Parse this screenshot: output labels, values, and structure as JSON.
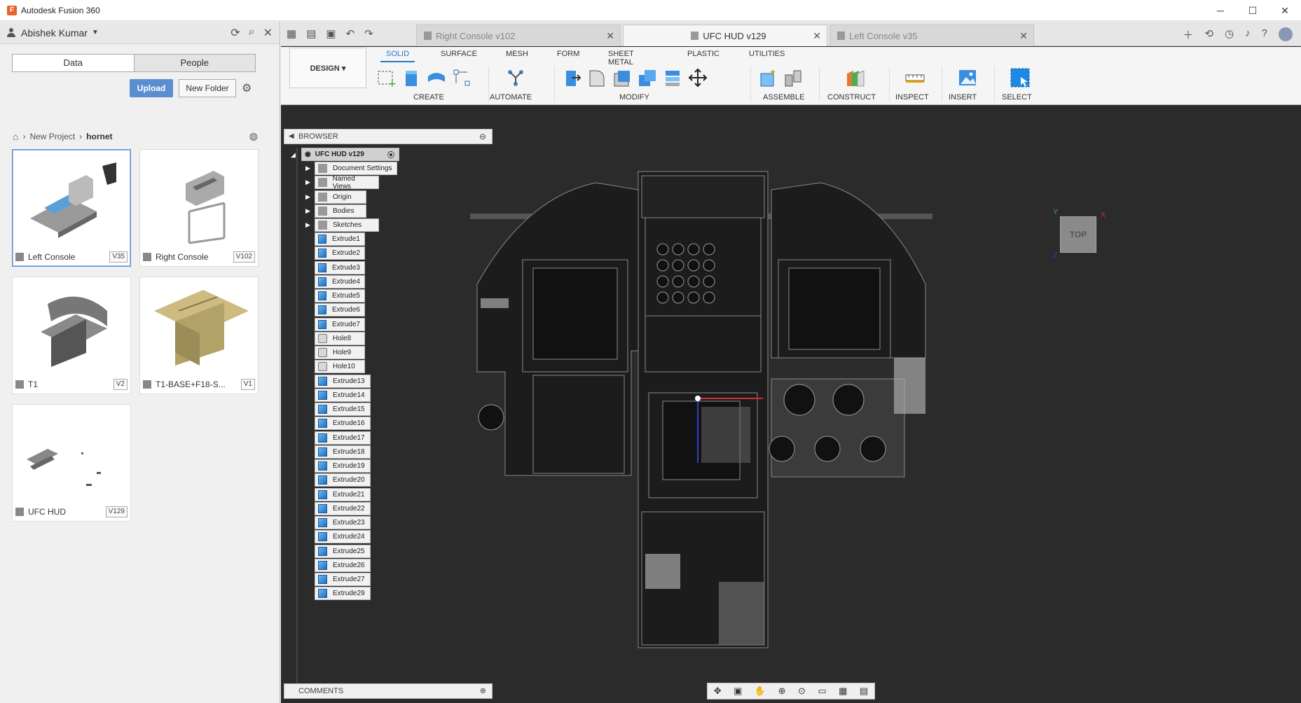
{
  "window": {
    "title": "Autodesk Fusion 360",
    "minimize": "─",
    "maximize": "☐",
    "close": "✕"
  },
  "data_panel": {
    "user": "Abishek Kumar",
    "tabs": [
      "Data",
      "People"
    ],
    "upload_label": "Upload",
    "new_folder_label": "New Folder",
    "breadcrumb": [
      "New Project",
      "hornet"
    ],
    "items": [
      {
        "name": "Left Console",
        "version": "V35"
      },
      {
        "name": "Right Console",
        "version": "V102"
      },
      {
        "name": "T1",
        "version": "V2"
      },
      {
        "name": "T1-BASE+F18-S...",
        "version": "V1"
      },
      {
        "name": "UFC HUD",
        "version": "V129"
      }
    ]
  },
  "doc_tabs": [
    {
      "label": "Right Console v102",
      "active": false
    },
    {
      "label": "UFC HUD v129",
      "active": true
    },
    {
      "label": "Left Console v35",
      "active": false
    }
  ],
  "ribbon": {
    "workspace": "DESIGN",
    "tabs": [
      "SOLID",
      "SURFACE",
      "MESH",
      "FORM",
      "SHEET METAL",
      "PLASTIC",
      "UTILITIES"
    ],
    "active_tab": "SOLID",
    "groups": [
      "CREATE",
      "AUTOMATE",
      "MODIFY",
      "ASSEMBLE",
      "CONSTRUCT",
      "INSPECT",
      "INSERT",
      "SELECT"
    ]
  },
  "browser": {
    "header": "BROWSER",
    "root": "UFC HUD v129",
    "folders": [
      "Document Settings",
      "Named Views",
      "Origin",
      "Bodies",
      "Sketches"
    ],
    "features": [
      "Extrude1",
      "Extrude2",
      "Extrude3",
      "Extrude4",
      "Extrude5",
      "Extrude6",
      "Extrude7",
      "Hole8",
      "Hole9",
      "Hole10",
      "Extrude13",
      "Extrude14",
      "Extrude15",
      "Extrude16",
      "Extrude17",
      "Extrude18",
      "Extrude19",
      "Extrude20",
      "Extrude21",
      "Extrude22",
      "Extrude23",
      "Extrude24",
      "Extrude25",
      "Extrude26",
      "Extrude27",
      "Extrude29"
    ]
  },
  "comments_label": "COMMENTS",
  "viewcube": {
    "face": "TOP",
    "x": "X",
    "y": "Y",
    "z": "Z"
  },
  "colors": {
    "accent": "#1e7bc7",
    "upload": "#5b8ed1",
    "viewport": "#2b2b2b"
  }
}
